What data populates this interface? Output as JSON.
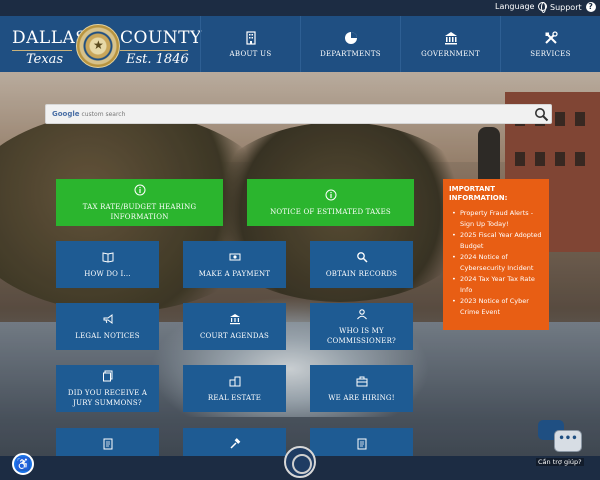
{
  "utility": {
    "language_label": "Language",
    "support_label": "Support",
    "help_icon": "?"
  },
  "brand": {
    "word_left": "DALLAS",
    "word_right": "COUNTY",
    "sub_left": "Texas",
    "sub_right": "Est. 1846",
    "seal_icon": "county-seal",
    "rule_color": "#c9b27b"
  },
  "nav": {
    "items": [
      {
        "label": "ABOUT US",
        "icon": "building-icon"
      },
      {
        "label": "DEPARTMENTS",
        "icon": "pie-chart-icon"
      },
      {
        "label": "GOVERNMENT",
        "icon": "capitol-icon"
      },
      {
        "label": "SERVICES",
        "icon": "tools-icon"
      }
    ]
  },
  "search": {
    "placeholder_brand": "Google",
    "placeholder_text": "custom search"
  },
  "tiles": {
    "hearing": "TAX RATE/BUDGET HEARING INFORMATION",
    "taxes": "NOTICE OF ESTIMATED TAXES",
    "howdoi": "HOW DO I...",
    "payment": "MAKE A PAYMENT",
    "records": "OBTAIN RECORDS",
    "legal": "LEGAL NOTICES",
    "agendas": "COURT AGENDAS",
    "commissioner": "WHO IS MY COMMISSIONER?",
    "jury": "DID YOU RECEIVE A JURY SUMMONS?",
    "realestate": "REAL ESTATE",
    "hiring": "WE ARE HIRING!"
  },
  "info": {
    "title": "IMPORTANT INFORMATION:",
    "items": [
      "Property Fraud Alerts - Sign Up Today!",
      "2025 Fiscal Year Adopted Budget",
      "2024 Notice of Cybersecurity Incident",
      "2024 Tax Year Tax Rate Info",
      "2023 Notice of Cyber Crime Event"
    ]
  },
  "chat": {
    "label": "Cần trợ giúp?"
  },
  "colors": {
    "header": "#1f4f82",
    "utility_bar": "#1c2c43",
    "green_tile": "#2bb52e",
    "blue_tile": "#1e5b93",
    "info_panel": "#e85e14"
  }
}
